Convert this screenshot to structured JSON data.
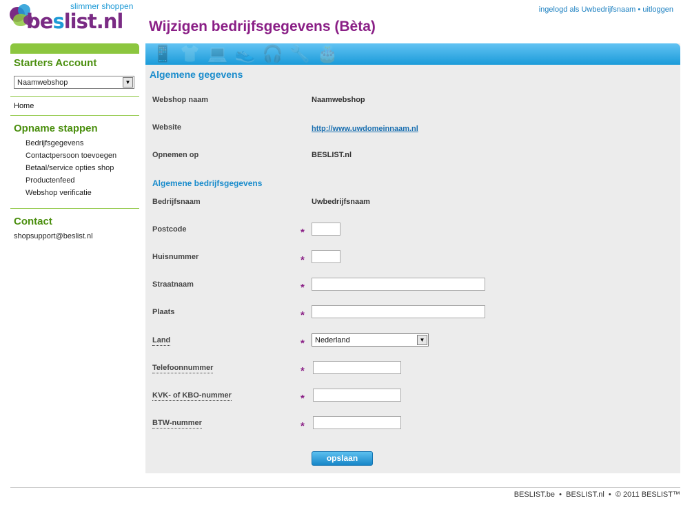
{
  "logo": {
    "tagline": "slimmer shoppen",
    "brand_prefix": "be",
    "brand_accent": "s",
    "brand_rest": "list.nl"
  },
  "title": "Wijzigen bedrijfsgegevens (Bèta)",
  "user": {
    "logged_in_text": "ingelogd als Uwbedrijfsnaam",
    "separator": "•",
    "logout": "uitloggen"
  },
  "sidebar": {
    "account_heading": "Starters Account",
    "shop_select": "Naamwebshop",
    "select_arrow": "▼",
    "home": "Home",
    "steps_heading": "Opname stappen",
    "steps": [
      "Bedrijfsgegevens",
      "Contactpersoon toevoegen",
      "Betaal/service opties shop",
      "Productenfeed",
      "Webshop verificatie"
    ],
    "contact_heading": "Contact",
    "contact_email": "shopsupport@beslist.nl"
  },
  "banner": {
    "icons": "📱👕💻👟🎧🔧🎂"
  },
  "general": {
    "heading": "Algemene gegevens",
    "shop_name_label": "Webshop naam",
    "shop_name_value": "Naamwebshop",
    "website_label": "Website",
    "website_value": "http://www.uwdomeinnaam.nl",
    "listed_label": "Opnemen op",
    "listed_value": "BESLIST.nl"
  },
  "company": {
    "heading": "Algemene bedrijfsgegevens",
    "name_label": "Bedrijfsnaam",
    "name_value": "Uwbedrijfsnaam",
    "required_mark": "*",
    "postcode_label": "Postcode",
    "postcode_value": "",
    "house_label": "Huisnummer",
    "house_value": "",
    "street_label": "Straatnaam",
    "street_value": "",
    "city_label": "Plaats",
    "city_value": "",
    "country_label": "Land",
    "country_value": "Nederland",
    "phone_label": "Telefoonnummer",
    "phone_value": "",
    "kvk_label": "KVK- of KBO-nummer",
    "kvk_value": "",
    "vat_label": "BTW-nummer",
    "vat_value": ""
  },
  "save_label": "opslaan",
  "footer": {
    "item1": "BESLIST.be",
    "sep": "•",
    "item2": "BESLIST.nl",
    "copyright": "© 2011 BESLIST™"
  },
  "colors": {
    "brand_purple": "#8a1f86",
    "brand_blue": "#1a8ccc",
    "brand_green": "#8cc63f"
  }
}
